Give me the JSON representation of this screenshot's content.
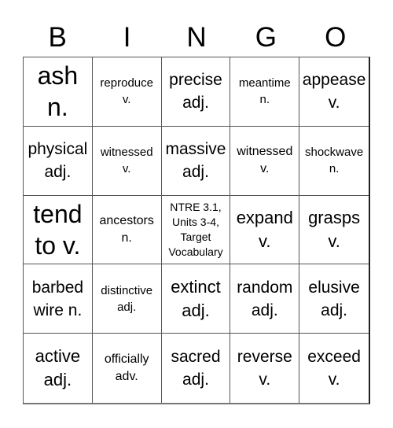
{
  "header": {
    "letters": [
      "B",
      "I",
      "N",
      "G",
      "O"
    ]
  },
  "card": {
    "cells": [
      {
        "text": "ash\nn.",
        "size": "s-xl"
      },
      {
        "text": "reproduce\nv.",
        "size": "s-xs"
      },
      {
        "text": "precise\nadj.",
        "size": "s-m"
      },
      {
        "text": "meantime\nn.",
        "size": "s-xs"
      },
      {
        "text": "appease\nv.",
        "size": "s-m"
      },
      {
        "text": "physical\nadj.",
        "size": "s-m"
      },
      {
        "text": "witnessed\nv.",
        "size": "s-xs"
      },
      {
        "text": "massive\nadj.",
        "size": "s-m"
      },
      {
        "text": "witnessed\nv.",
        "size": "s-s"
      },
      {
        "text": "shockwave\nn.",
        "size": "s-xs"
      },
      {
        "text": "tend\nto v.",
        "size": "s-xl"
      },
      {
        "text": "ancestors\nn.",
        "size": "s-s"
      },
      {
        "text": "NTRE 3.1,\nUnits 3-4,\nTarget\nVocabulary",
        "size": "s-free"
      },
      {
        "text": "expand\nv.",
        "size": "s-l"
      },
      {
        "text": "grasps\nv.",
        "size": "s-l"
      },
      {
        "text": "barbed\nwire n.",
        "size": "s-m"
      },
      {
        "text": "distinctive\nadj.",
        "size": "s-xs"
      },
      {
        "text": "extinct\nadj.",
        "size": "s-l"
      },
      {
        "text": "random\nadj.",
        "size": "s-m"
      },
      {
        "text": "elusive\nadj.",
        "size": "s-m"
      },
      {
        "text": "active\nadj.",
        "size": "s-l"
      },
      {
        "text": "officially\nadv.",
        "size": "s-s"
      },
      {
        "text": "sacred\nadj.",
        "size": "s-m"
      },
      {
        "text": "reverse\nv.",
        "size": "s-m"
      },
      {
        "text": "exceed\nv.",
        "size": "s-m"
      }
    ]
  }
}
